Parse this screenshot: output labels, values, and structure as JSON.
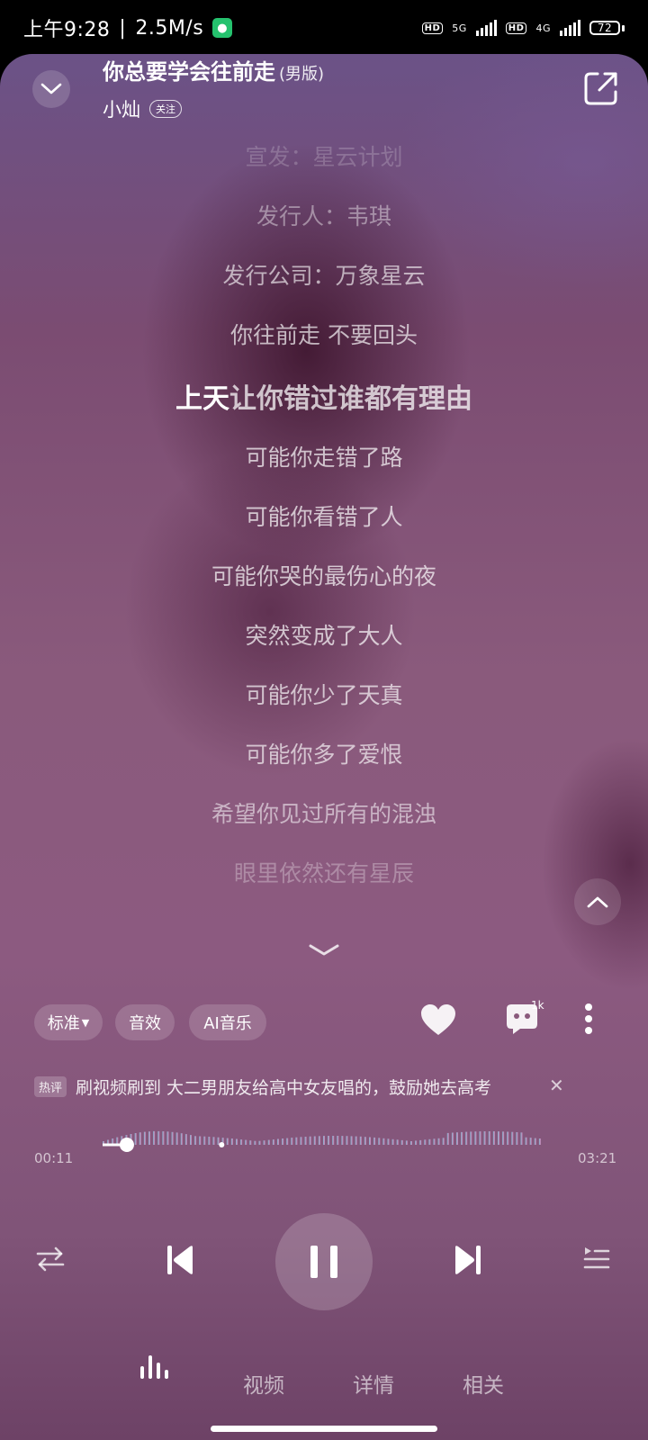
{
  "status_bar": {
    "time": "上午9:28",
    "net_speed": "2.5M/s",
    "hd1": "HD",
    "net1": "5G",
    "hd2": "HD",
    "net2": "4G",
    "battery": "72"
  },
  "header": {
    "title": "你总要学会往前走",
    "version": "(男版)",
    "artist": "小灿",
    "follow_label": "关注"
  },
  "lyrics": [
    {
      "text": "宣发：星云计划",
      "opacity": 0.2
    },
    {
      "text": "发行人：韦琪",
      "opacity": 0.42
    },
    {
      "text": "发行公司：万象星云",
      "opacity": 0.62
    },
    {
      "text": "你往前走 不要回头",
      "opacity": 0.68
    },
    {
      "text": "可能你走错了路",
      "opacity": 0.7
    },
    {
      "text": "可能你看错了人",
      "opacity": 0.7
    },
    {
      "text": "可能你哭的最伤心的夜",
      "opacity": 0.7
    },
    {
      "text": "突然变成了大人",
      "opacity": 0.7
    },
    {
      "text": "可能你少了天真",
      "opacity": 0.68
    },
    {
      "text": "可能你多了爱恨",
      "opacity": 0.65
    },
    {
      "text": "希望你见过所有的混浊",
      "opacity": 0.55
    },
    {
      "text": "眼里依然还有星辰",
      "opacity": 0.3
    }
  ],
  "current_lyric": {
    "sung": "上天",
    "rest": "让你错过谁都有理由"
  },
  "options": {
    "quality": "标准",
    "effect": "音效",
    "ai_music": "AI音乐",
    "comment_count": "1k"
  },
  "hot_comment": {
    "tag": "热评",
    "text": "刷视频刷到 大二男朋友给高中女友唱的，鼓励她去高考"
  },
  "progress": {
    "current": "00:11",
    "total": "03:21",
    "fraction": 0.055
  },
  "tabs": {
    "video": "视频",
    "detail": "详情",
    "related": "相关"
  },
  "colors": {
    "wave_start": "#7fd8ee",
    "wave_end": "#e88ec6"
  }
}
